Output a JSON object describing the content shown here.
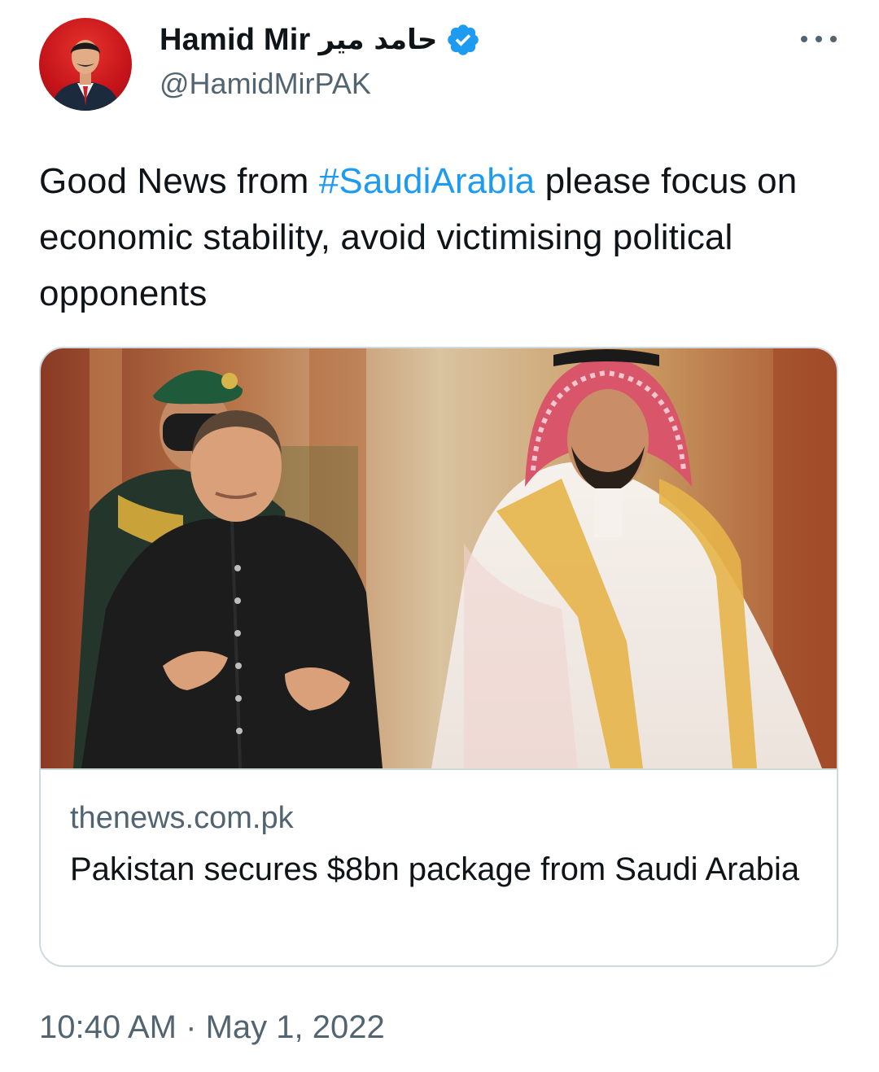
{
  "author": {
    "display_name": "Hamid Mir",
    "urdu_name": "حامد میر",
    "handle": "@HamidMirPAK",
    "verified": true,
    "avatar_icon": "profile-photo"
  },
  "tweet": {
    "text_before": "Good News from ",
    "hashtag": "#SaudiArabia",
    "text_after": " please focus on economic stability, avoid victimising political opponents"
  },
  "link_card": {
    "domain": "thenews.com.pk",
    "title": "Pakistan secures $8bn package from Saudi Arabia",
    "image_icon": "news-photo"
  },
  "meta": {
    "time": "10:40 AM",
    "separator": " · ",
    "date": "May 1, 2022"
  },
  "colors": {
    "accent": "#1d9bf0",
    "text_primary": "#0f1419",
    "text_secondary": "#536471",
    "border": "#cfd9de"
  }
}
